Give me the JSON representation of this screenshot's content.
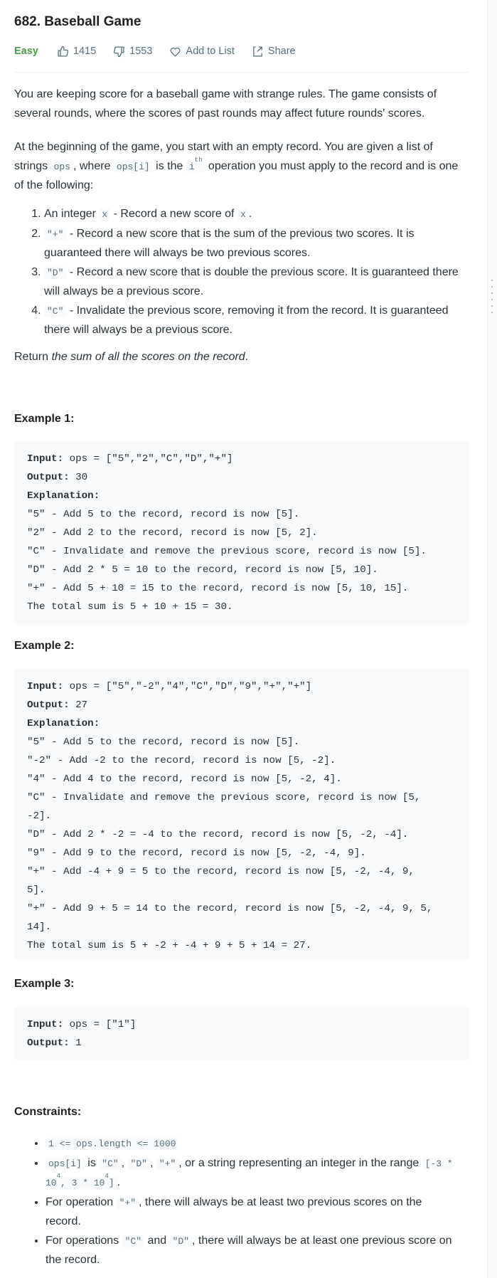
{
  "title": "682. Baseball Game",
  "meta": {
    "difficulty": "Easy",
    "likes": "1415",
    "dislikes": "1553",
    "add_to_list": "Add to List",
    "share": "Share",
    "difficulty_color": "#43a047"
  },
  "desc": {
    "p1": "You are keeping score for a baseball game with strange rules. The game consists of several rounds, where the scores of past rounds may affect future rounds' scores.",
    "p2a": "At the beginning of the game, you start with an empty record. You are given a list of strings ",
    "p2code1": "ops",
    "p2b": ", where ",
    "p2code2": "ops[i]",
    "p2c": " is the ",
    "p2code3": "i",
    "p2sup": "th",
    "p2d": " operation you must apply to the record and is one of the following:",
    "items": [
      {
        "a": "An integer ",
        "code": "x",
        "b": " - Record a new score of ",
        "code2": "x",
        "c": "."
      },
      {
        "code": "\"+\"",
        "b": " - Record a new score that is the sum of the previous two scores. It is guaranteed there will always be two previous scores."
      },
      {
        "code": "\"D\"",
        "b": " - Record a new score that is double the previous score. It is guaranteed there will always be a previous score."
      },
      {
        "code": "\"C\"",
        "b": " - Invalidate the previous score, removing it from the record. It is guaranteed there will always be a previous score."
      }
    ],
    "ret_a": "Return ",
    "ret_em": "the sum of all the scores on the record",
    "ret_b": "."
  },
  "examples": [
    {
      "heading": "Example 1:",
      "input_label": "Input:",
      "input": " ops = [\"5\",\"2\",\"C\",\"D\",\"+\"]",
      "output_label": "Output:",
      "output": " 30",
      "expl_label": "Explanation:",
      "lines": [
        "\"5\" - Add 5 to the record, record is now [5].",
        "\"2\" - Add 2 to the record, record is now [5, 2].",
        "\"C\" - Invalidate and remove the previous score, record is now [5].",
        "\"D\" - Add 2 * 5 = 10 to the record, record is now [5, 10].",
        "\"+\" - Add 5 + 10 = 15 to the record, record is now [5, 10, 15].",
        "The total sum is 5 + 10 + 15 = 30."
      ]
    },
    {
      "heading": "Example 2:",
      "input_label": "Input:",
      "input": " ops = [\"5\",\"-2\",\"4\",\"C\",\"D\",\"9\",\"+\",\"+\"]",
      "output_label": "Output:",
      "output": " 27",
      "expl_label": "Explanation:",
      "lines": [
        "\"5\" - Add 5 to the record, record is now [5].",
        "\"-2\" - Add -2 to the record, record is now [5, -2].",
        "\"4\" - Add 4 to the record, record is now [5, -2, 4].",
        "\"C\" - Invalidate and remove the previous score, record is now [5,",
        "-2].",
        "\"D\" - Add 2 * -2 = -4 to the record, record is now [5, -2, -4].",
        "\"9\" - Add 9 to the record, record is now [5, -2, -4, 9].",
        "\"+\" - Add -4 + 9 = 5 to the record, record is now [5, -2, -4, 9,",
        "5].",
        "\"+\" - Add 9 + 5 = 14 to the record, record is now [5, -2, -4, 9, 5,",
        "14].",
        "The total sum is 5 + -2 + -4 + 9 + 5 + 14 = 27."
      ]
    },
    {
      "heading": "Example 3:",
      "input_label": "Input:",
      "input": " ops = [\"1\"]",
      "output_label": "Output:",
      "output": " 1"
    }
  ],
  "constraints": {
    "heading": "Constraints:",
    "c1": "1 <= ops.length <= 1000",
    "c2code": "ops[i]",
    "c2a": " is ",
    "c2q1": "\"C\"",
    "c2s1": ", ",
    "c2q2": "\"D\"",
    "c2s2": ", ",
    "c2q3": "\"+\"",
    "c2b": ", or a string representing an integer in the range ",
    "c2r1": "[-3 * 10",
    "c2e1": "4",
    "c2r2": ", 3 * 10",
    "c2e2": "4",
    "c2r3": "]",
    "c2c": ".",
    "c3a": "For operation ",
    "c3code": "\"+\"",
    "c3b": ", there will always be at least two previous scores on the record.",
    "c4a": "For operations ",
    "c4q1": "\"C\"",
    "c4and": " and ",
    "c4q2": "\"D\"",
    "c4b": ", there will always be at least one previous score on the record."
  }
}
